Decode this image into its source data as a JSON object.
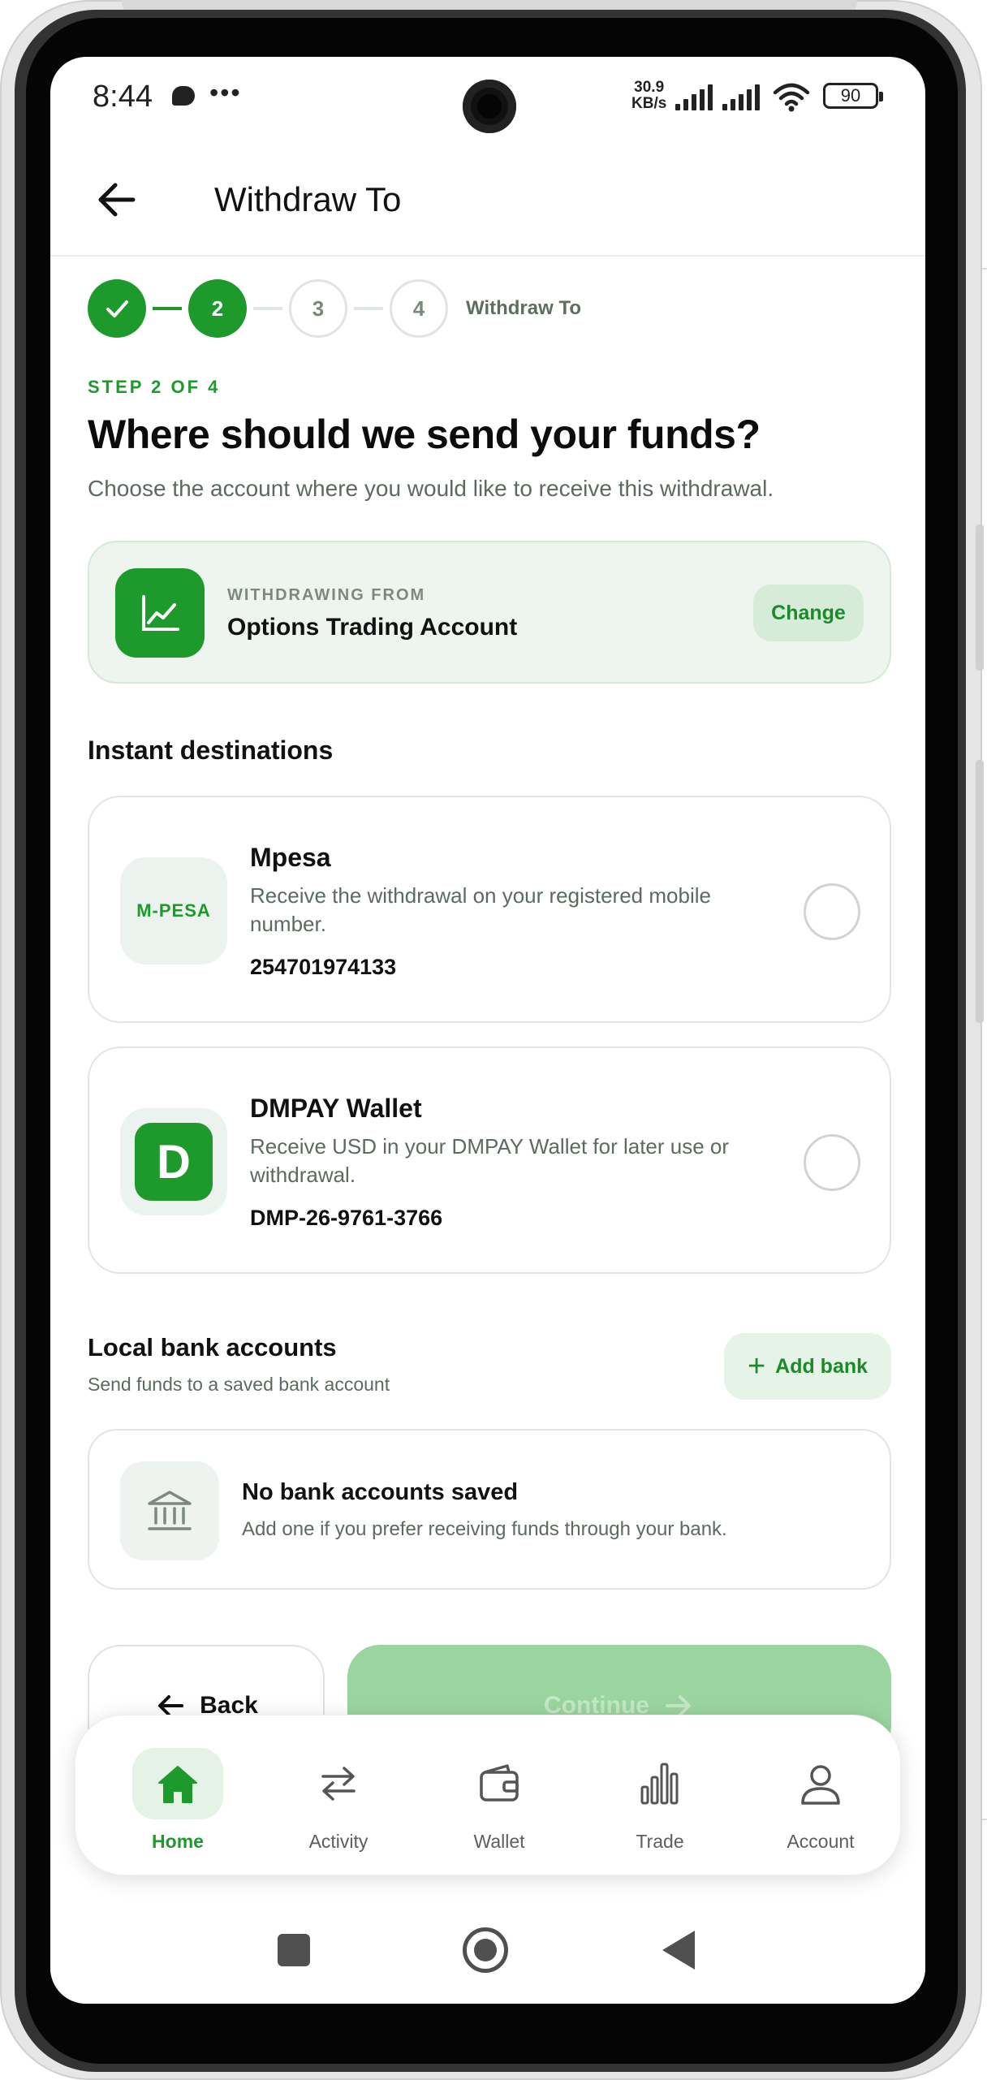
{
  "status_bar": {
    "time": "8:44",
    "speed_value": "30.9",
    "speed_unit": "KB/s",
    "battery": "90"
  },
  "header": {
    "title": "Withdraw To"
  },
  "stepper": {
    "steps": [
      "",
      "2",
      "3",
      "4"
    ],
    "label": "Withdraw To"
  },
  "intro": {
    "kicker": "STEP 2 OF 4",
    "title": "Where should we send your funds?",
    "subtitle": "Choose the account where you would like to receive this withdrawal."
  },
  "source": {
    "kicker": "WITHDRAWING FROM",
    "name": "Options Trading Account",
    "change_label": "Change"
  },
  "instant": {
    "title": "Instant destinations",
    "items": [
      {
        "logo_text": "M-PESA",
        "name": "Mpesa",
        "description": "Receive the withdrawal on your registered mobile number.",
        "account": "254701974133",
        "selected": false
      },
      {
        "logo_text": "D",
        "name": "DMPAY Wallet",
        "description": "Receive USD in your DMPAY Wallet for later use or withdrawal.",
        "account": "DMP-26-9761-3766",
        "selected": false
      }
    ]
  },
  "bank": {
    "title": "Local bank accounts",
    "subtitle": "Send funds to a saved bank account",
    "add_label": "Add bank",
    "empty_title": "No bank accounts saved",
    "empty_desc": "Add one if you prefer receiving funds through your bank."
  },
  "actions": {
    "back_label": "Back",
    "continue_label": "Continue"
  },
  "bottom_nav": {
    "items": [
      {
        "label": "Home",
        "icon": "home-icon",
        "active": true
      },
      {
        "label": "Activity",
        "icon": "swap-arrows-icon",
        "active": false
      },
      {
        "label": "Wallet",
        "icon": "wallet-icon",
        "active": false
      },
      {
        "label": "Trade",
        "icon": "bar-chart-icon",
        "active": false
      },
      {
        "label": "Account",
        "icon": "user-icon",
        "active": false
      }
    ]
  },
  "colors": {
    "brand": "#1e9a2c",
    "brand_light": "#e4f3e6",
    "continue_disabled": "#9ad59f"
  }
}
